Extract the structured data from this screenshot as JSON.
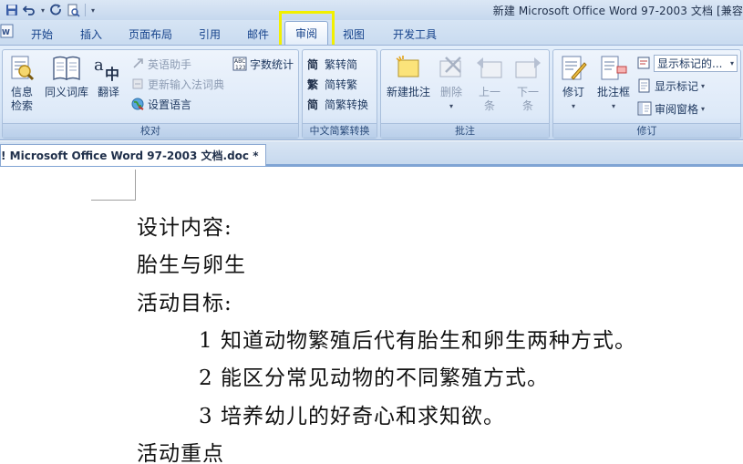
{
  "window": {
    "title": "新建 Microsoft Office Word 97-2003 文档 [兼容"
  },
  "tabs": [
    {
      "label": "开始"
    },
    {
      "label": "插入"
    },
    {
      "label": "页面布局"
    },
    {
      "label": "引用"
    },
    {
      "label": "邮件"
    },
    {
      "label": "审阅"
    },
    {
      "label": "视图"
    },
    {
      "label": "开发工具"
    }
  ],
  "ribbon": {
    "proofing": {
      "label": "校对",
      "info_line1": "信息",
      "info_line2": "检索",
      "thesaurus": "同义词库",
      "translate": "翻译",
      "english_assistant": "英语助手",
      "update_ime": "更新输入法词典",
      "set_language": "设置语言",
      "word_count": "字数统计"
    },
    "chinese": {
      "label": "中文简繁转换",
      "trad_to_simp": "繁转简",
      "simp_to_trad": "简转繁",
      "convert": "简繁转换"
    },
    "comments": {
      "label": "批注",
      "new_comment": "新建批注",
      "delete": "删除",
      "prev_line1": "上一",
      "prev_line2": "条",
      "next_line1": "下一",
      "next_line2": "条"
    },
    "tracking": {
      "label": "修订",
      "track_changes": "修订",
      "balloons": "批注框",
      "display_value": "显示标记的...",
      "show_markup": "显示标记",
      "reviewing_pane": "审阅窗格"
    }
  },
  "document_tab": {
    "label": "! Microsoft Office Word 97-2003 文档.doc *"
  },
  "document": {
    "lines": [
      "设计内容:",
      "胎生与卵生",
      "活动目标:",
      "1  知道动物繁殖后代有胎生和卵生两种方式。",
      "2  能区分常见动物的不同繁殖方式。",
      "3  培养幼儿的好奇心和求知欲。",
      "活动重点"
    ]
  }
}
